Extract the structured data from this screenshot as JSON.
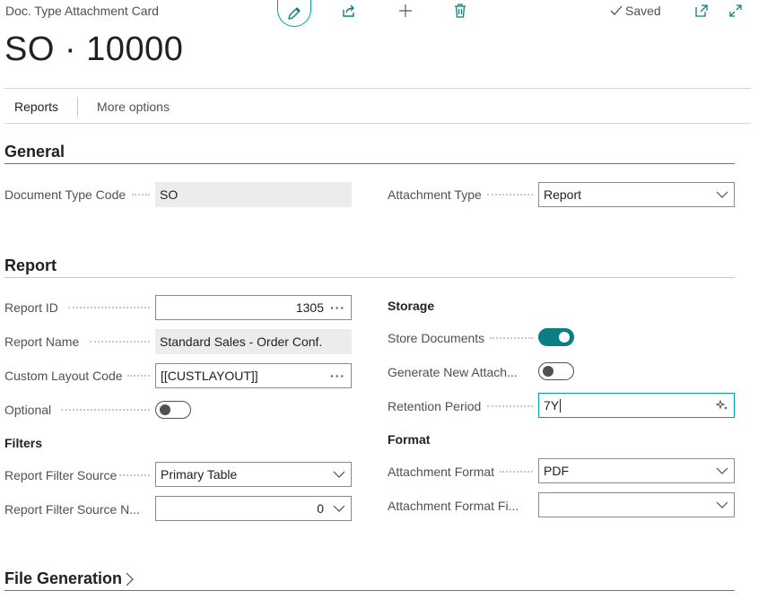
{
  "header": {
    "page_type": "Doc. Type Attachment Card",
    "record_title": "SO · 10000",
    "status": "Saved"
  },
  "actions": {
    "reports": "Reports",
    "more_options": "More options"
  },
  "general": {
    "title": "General",
    "document_type_code": {
      "label": "Document Type Code",
      "value": "SO"
    },
    "attachment_type": {
      "label": "Attachment Type",
      "value": "Report"
    }
  },
  "report": {
    "title": "Report",
    "report_id": {
      "label": "Report ID",
      "value": "1305"
    },
    "report_name": {
      "label": "Report Name",
      "value": "Standard Sales - Order Conf."
    },
    "custom_layout_code": {
      "label": "Custom Layout Code",
      "value": "[[CUSTLAYOUT]]"
    },
    "optional": {
      "label": "Optional",
      "value": false
    },
    "filters_heading": "Filters",
    "report_filter_source": {
      "label": "Report Filter Source",
      "value": "Primary Table"
    },
    "report_filter_source_no": {
      "label": "Report Filter Source N...",
      "value": "0"
    },
    "storage_heading": "Storage",
    "store_documents": {
      "label": "Store Documents",
      "value": true
    },
    "generate_new_attach": {
      "label": "Generate New Attach...",
      "value": false
    },
    "retention_period": {
      "label": "Retention Period",
      "value": "7Y"
    },
    "format_heading": "Format",
    "attachment_format": {
      "label": "Attachment Format",
      "value": "PDF"
    },
    "attachment_format_fi": {
      "label": "Attachment Format Fi...",
      "value": ""
    }
  },
  "file_generation": {
    "title": "File Generation"
  },
  "colors": {
    "accent": "#00a0a8",
    "toggle_on": "#0b7e83"
  }
}
